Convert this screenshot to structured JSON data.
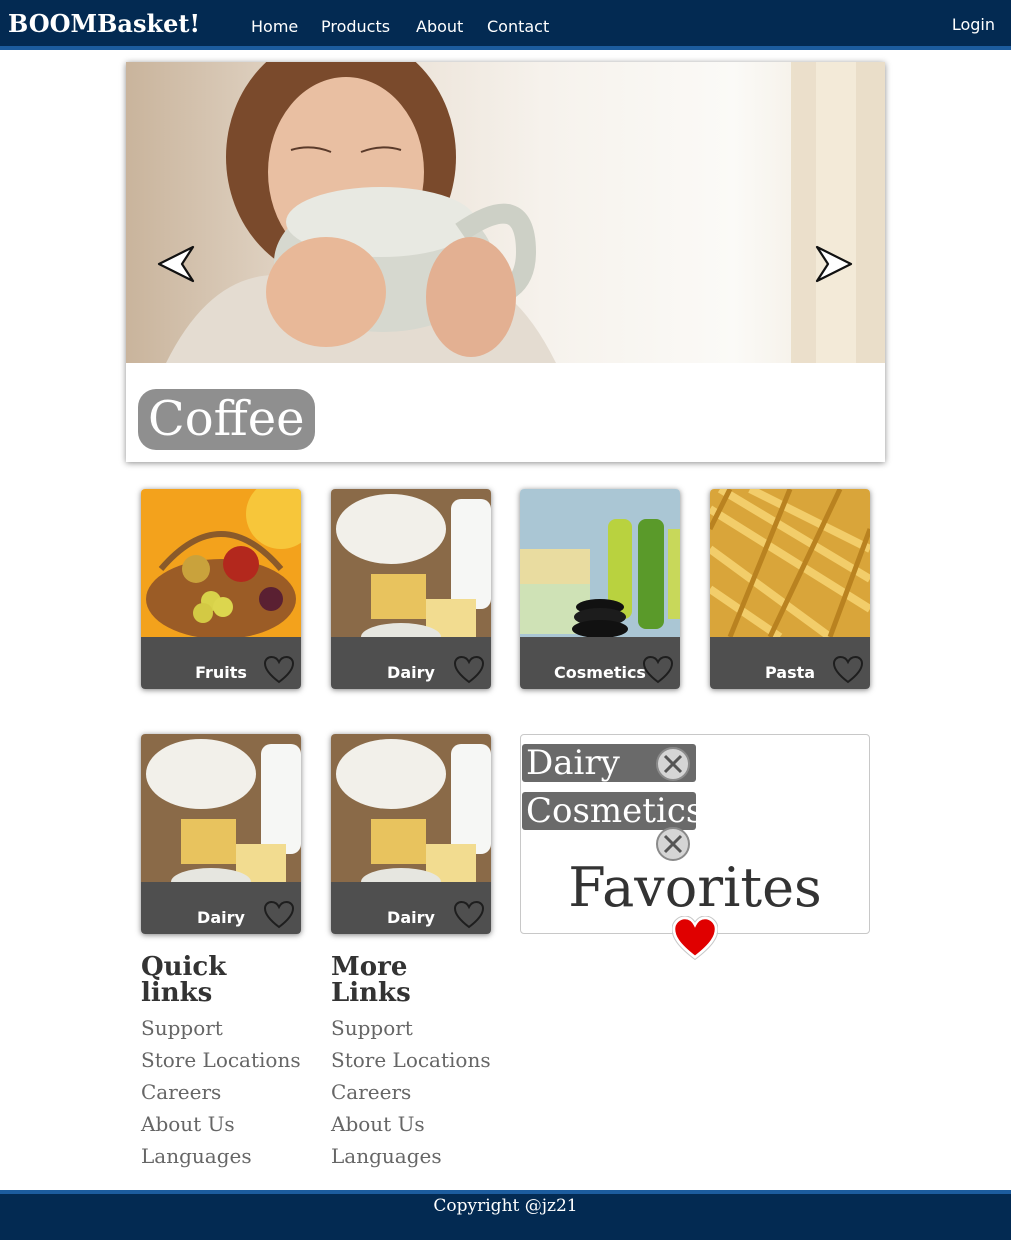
{
  "header": {
    "brand": "BOOMBasket!",
    "nav": [
      "Home",
      "Products",
      "About",
      "Contact"
    ],
    "login": "Login"
  },
  "hero": {
    "caption": "Coffee",
    "prev_icon": "chevron-left-icon",
    "next_icon": "chevron-right-icon"
  },
  "categories": [
    {
      "label": "Fruits"
    },
    {
      "label": "Dairy"
    },
    {
      "label": "Cosmetics"
    },
    {
      "label": "Pasta"
    }
  ],
  "more_cards": [
    {
      "label": "Dairy"
    },
    {
      "label": "Dairy"
    }
  ],
  "favorites": {
    "title": "Favorites",
    "items": [
      "Dairy",
      "Cosmetics"
    ],
    "remove_icon": "close-icon",
    "heart_icon": "heart-icon",
    "heart_color": "#e00000"
  },
  "quick_links": {
    "title": "Quick links",
    "items": [
      "Support",
      "Store Locations",
      "Careers",
      "About Us",
      "Languages"
    ]
  },
  "more_links": {
    "title": "More Links",
    "items": [
      "Support",
      "Store Locations",
      "Careers",
      "About Us",
      "Languages"
    ]
  },
  "footer": {
    "copyright": "Copyright @jz21"
  },
  "colors": {
    "navbar": "#032a52",
    "accent": "#1c5c9e",
    "caption_pill": "#8f8f8f",
    "chip": "#6a6a6a"
  }
}
